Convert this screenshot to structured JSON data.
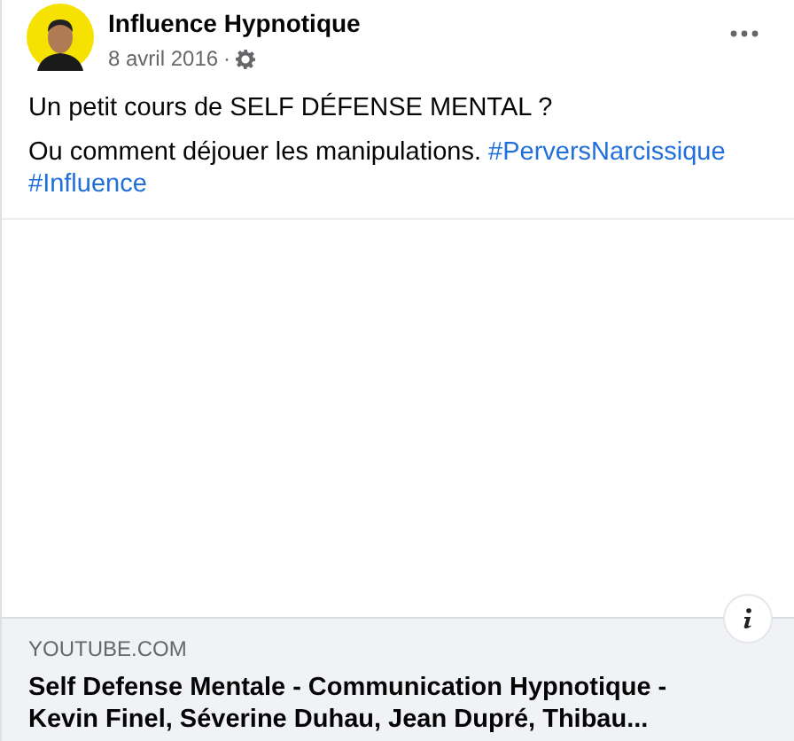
{
  "post": {
    "author": "Influence Hypnotique",
    "date": "8 avril 2016",
    "separator": "·",
    "paragraphs": [
      {
        "text": "Un petit cours de SELF DÉFENSE MENTAL ?"
      },
      {
        "text": "Ou comment déjouer les manipulations.",
        "hashtags": [
          "#PerversNarcissique",
          "#Influence"
        ]
      }
    ]
  },
  "link_preview": {
    "domain": "YOUTUBE.COM",
    "title": "Self Defense Mentale - Communication Hypnotique - Kevin Finel, Séverine Duhau, Jean Dupré, Thibau..."
  }
}
